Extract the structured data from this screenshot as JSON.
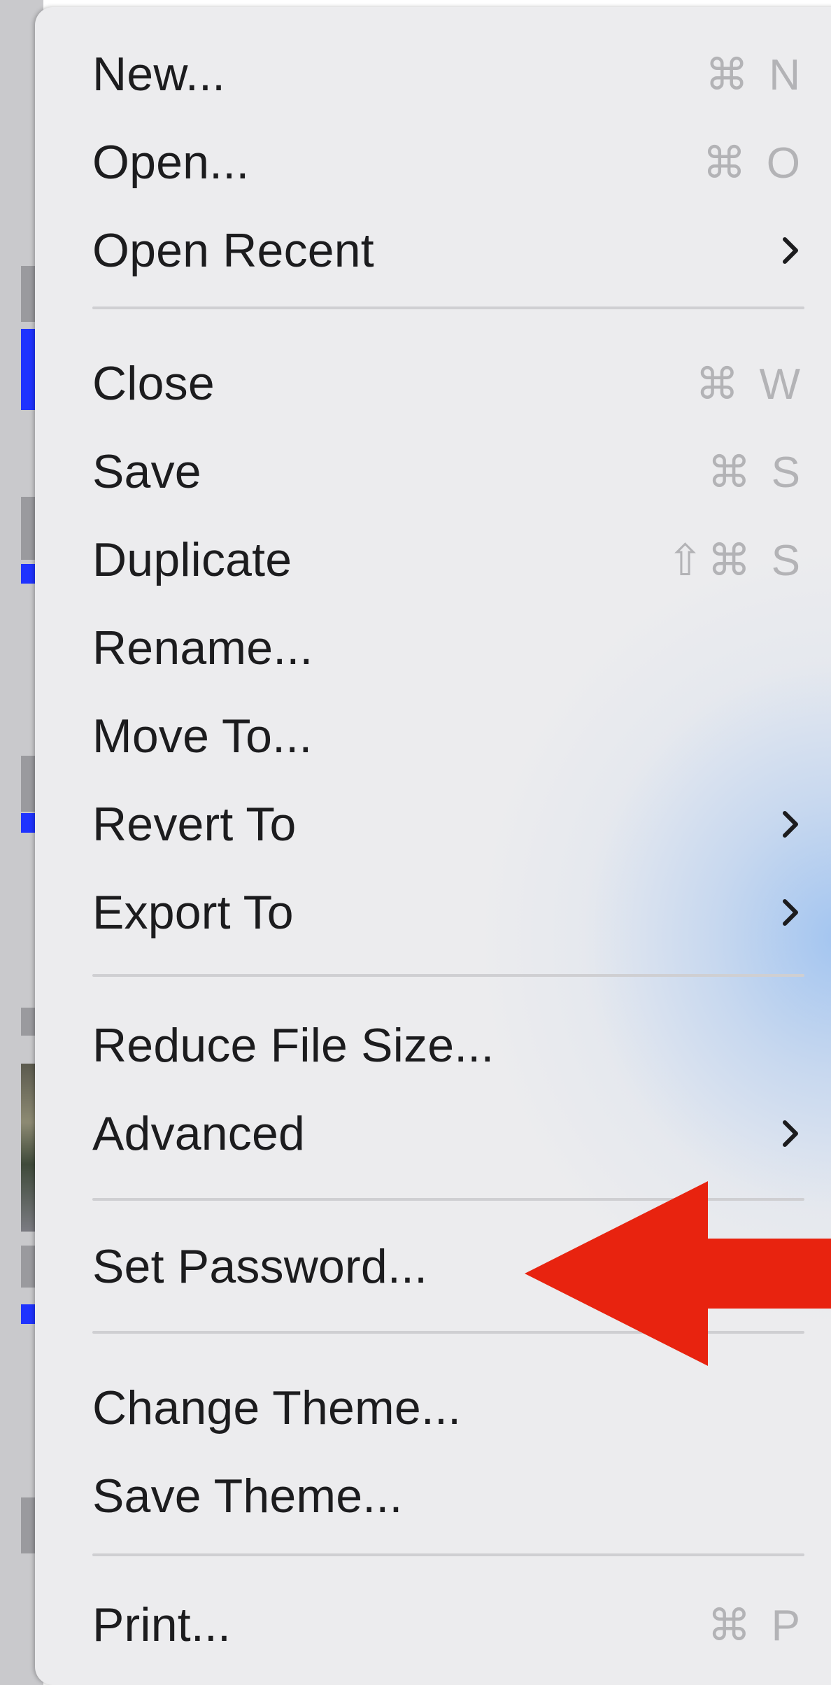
{
  "menu": {
    "groups": [
      [
        {
          "label": "New...",
          "shortcut": "⌘ N",
          "submenu": false
        },
        {
          "label": "Open...",
          "shortcut": "⌘ O",
          "submenu": false
        },
        {
          "label": "Open Recent",
          "shortcut": "",
          "submenu": true
        }
      ],
      [
        {
          "label": "Close",
          "shortcut": "⌘ W",
          "submenu": false
        },
        {
          "label": "Save",
          "shortcut": "⌘ S",
          "submenu": false
        },
        {
          "label": "Duplicate",
          "shortcut": "⇧⌘ S",
          "submenu": false
        },
        {
          "label": "Rename...",
          "shortcut": "",
          "submenu": false
        },
        {
          "label": "Move To...",
          "shortcut": "",
          "submenu": false
        },
        {
          "label": "Revert To",
          "shortcut": "",
          "submenu": true
        },
        {
          "label": "Export To",
          "shortcut": "",
          "submenu": true
        }
      ],
      [
        {
          "label": "Reduce File Size...",
          "shortcut": "",
          "submenu": false
        },
        {
          "label": "Advanced",
          "shortcut": "",
          "submenu": true
        }
      ],
      [
        {
          "label": "Set Password...",
          "shortcut": "",
          "submenu": false
        }
      ],
      [
        {
          "label": "Change Theme...",
          "shortcut": "",
          "submenu": false
        },
        {
          "label": "Save Theme...",
          "shortcut": "",
          "submenu": false
        }
      ],
      [
        {
          "label": "Print...",
          "shortcut": "⌘ P",
          "submenu": false
        }
      ]
    ]
  },
  "annotation": {
    "arrow_color": "#e8230f",
    "points_to": "Set Password..."
  },
  "colors": {
    "menu_background": "#ececee",
    "text": "#1c1c1e",
    "shortcut_text": "#b3b3b6",
    "separator": "#cfcfd2",
    "background_highlight_blue": "#1f33ff"
  }
}
